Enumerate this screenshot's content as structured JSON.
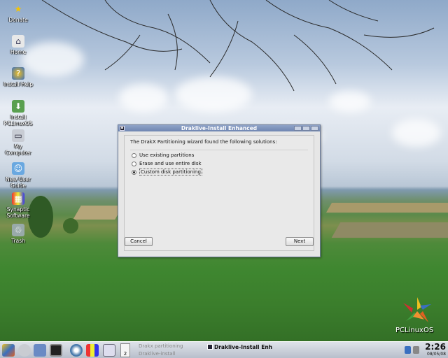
{
  "desktop": {
    "icons": [
      {
        "label": "Donate",
        "icon": "star-icon"
      },
      {
        "label": "Home",
        "icon": "home-folder-icon"
      },
      {
        "label": "Install Help",
        "icon": "help-icon"
      },
      {
        "label": "Install\nPCLinuxOS",
        "icon": "install-icon"
      },
      {
        "label": "My\nComputer",
        "icon": "computer-icon"
      },
      {
        "label": "New User\nGuide",
        "icon": "user-guide-icon"
      },
      {
        "label": "Synaptic\nSoftware",
        "icon": "synaptic-icon"
      },
      {
        "label": "Trash",
        "icon": "trash-icon"
      }
    ],
    "logo_text": "PCLinuxOS"
  },
  "dialog": {
    "title": "Draklive-Install Enhanced",
    "prompt": "The DrakX Partitioning wizard found the following solutions:",
    "options": [
      {
        "label": "Use existing partitions",
        "checked": false
      },
      {
        "label": "Erase and use entire disk",
        "checked": false
      },
      {
        "label": "Custom disk partitioning",
        "checked": true
      }
    ],
    "cancel_label": "Cancel",
    "next_label": "Next"
  },
  "taskbar": {
    "pager_number": "2",
    "inactive_tasks": [
      "Drakx partitioning",
      "Draklive-install"
    ],
    "active_task": "Draklive-Install Enh",
    "time": "2:26",
    "date": "08/05/08"
  },
  "colors": {
    "titlebar": "#7a8fba",
    "dialog_bg": "#e6e6e6"
  }
}
